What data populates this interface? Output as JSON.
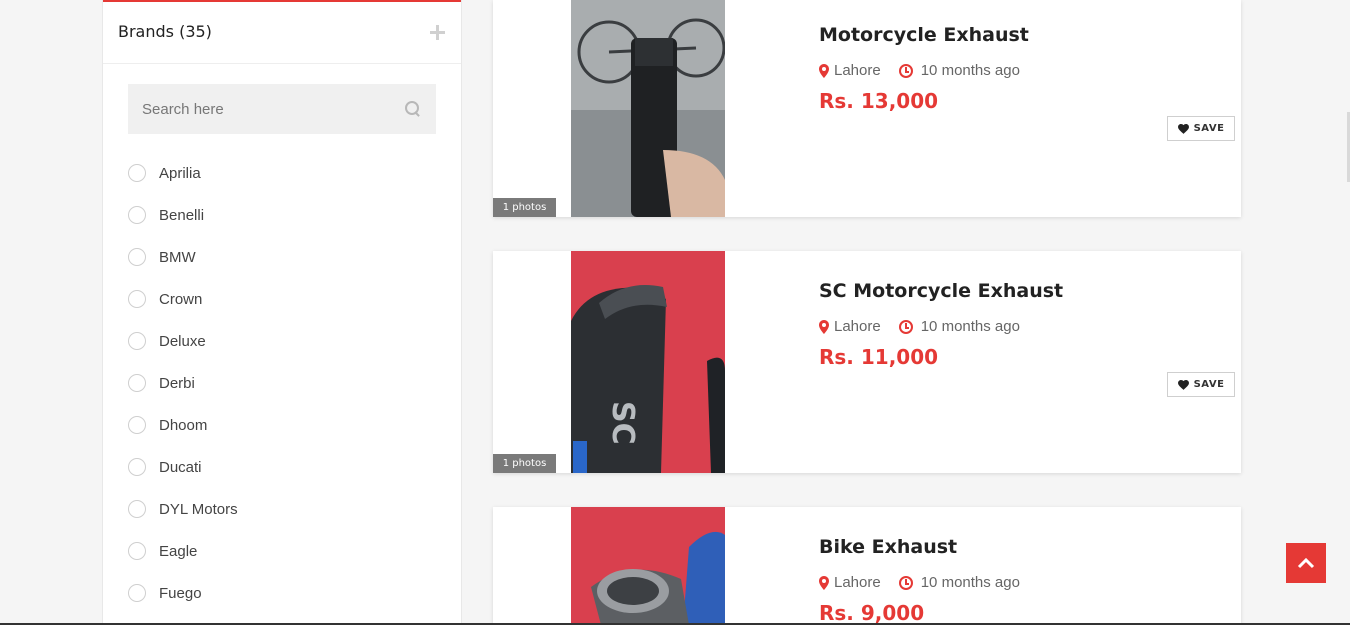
{
  "sidebar": {
    "brands_title": "Brands (35)",
    "search_placeholder": "Search here",
    "brands": [
      "Aprilia",
      "Benelli",
      "BMW",
      "Crown",
      "Deluxe",
      "Derbi",
      "Dhoom",
      "Ducati",
      "DYL Motors",
      "Eagle",
      "Fuego"
    ]
  },
  "listings": [
    {
      "title": "Motorcycle Exhaust",
      "location": "Lahore",
      "time": "10 months ago",
      "price": "Rs. 13,000",
      "photos": "1 photos",
      "save": "SAVE"
    },
    {
      "title": "SC Motorcycle Exhaust",
      "location": "Lahore",
      "time": "10 months ago",
      "price": "Rs. 11,000",
      "photos": "1 photos",
      "save": "SAVE"
    },
    {
      "title": "Bike Exhaust",
      "location": "Lahore",
      "time": "10 months ago",
      "price": "Rs. 9,000"
    }
  ],
  "colors": {
    "accent": "#e53935",
    "text": "#222222",
    "muted": "#666666"
  },
  "icons": {
    "plus": "plus-icon",
    "search": "search-icon",
    "pin": "map-pin-icon",
    "clock": "clock-icon",
    "heart": "heart-icon",
    "scroll_top": "chevron-up-icon"
  }
}
